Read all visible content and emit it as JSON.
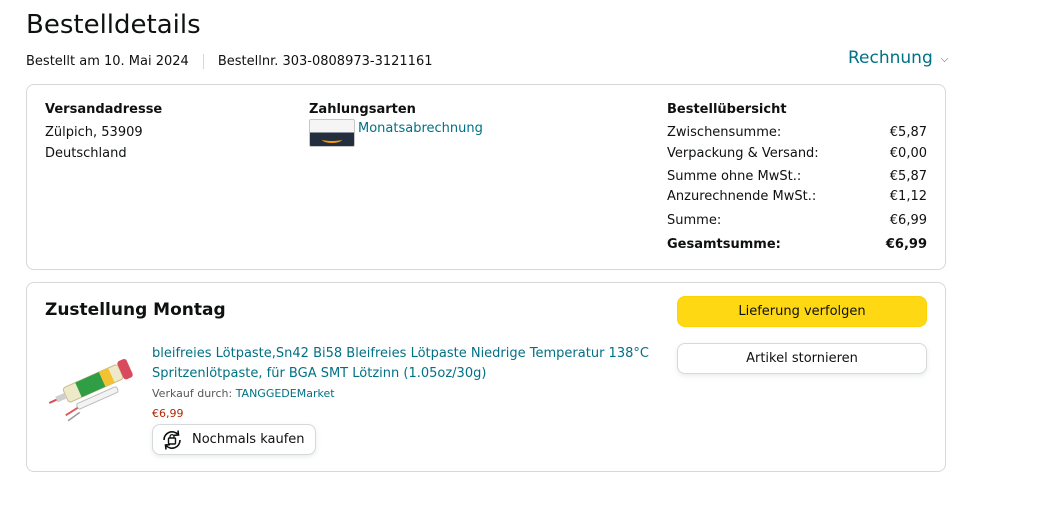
{
  "page": {
    "title": "Bestelldetails"
  },
  "meta": {
    "ordered_on": "Bestellt am 10. Mai 2024",
    "order_number": "Bestellnr. 303-0808973-3121161"
  },
  "invoice": {
    "label": "Rechnung"
  },
  "shipping_address": {
    "heading": "Versandadresse",
    "line1": "Zülpich, 53909",
    "line2": "Deutschland"
  },
  "payment": {
    "heading": "Zahlungsarten",
    "method": "Monatsabrechnung",
    "icon": "amazon-card-icon"
  },
  "summary": {
    "heading": "Bestellübersicht",
    "rows": [
      {
        "label": "Zwischensumme:",
        "value": "€5,87"
      },
      {
        "label": "Verpackung & Versand:",
        "value": "€0,00"
      },
      {
        "label": "Summe ohne MwSt.:",
        "value": "€5,87"
      },
      {
        "label": "Anzurechnende MwSt.:",
        "value": "€1,12"
      },
      {
        "label": "Summe:",
        "value": "€6,99"
      },
      {
        "label": "Gesamtsumme:",
        "value": "€6,99"
      }
    ]
  },
  "shipment": {
    "title": "Zustellung Montag",
    "track_button": "Lieferung verfolgen",
    "cancel_button": "Artikel stornieren",
    "product": {
      "title": "bleifreies Lötpaste,Sn42 Bi58 Bleifreies Lötpaste Niedrige Temperatur 138°C Spritzenlötpaste, für BGA SMT Lötzinn (1.05oz/30g)",
      "seller_prefix": "Verkauf durch: ",
      "seller_name": "TANGGEDEMarket",
      "price": "€6,99",
      "rebuy_button": "Nochmals kaufen"
    }
  },
  "colors": {
    "link": "#007185",
    "primary_button": "#ffd814",
    "price": "#b12704",
    "border": "#d5d9d9"
  }
}
